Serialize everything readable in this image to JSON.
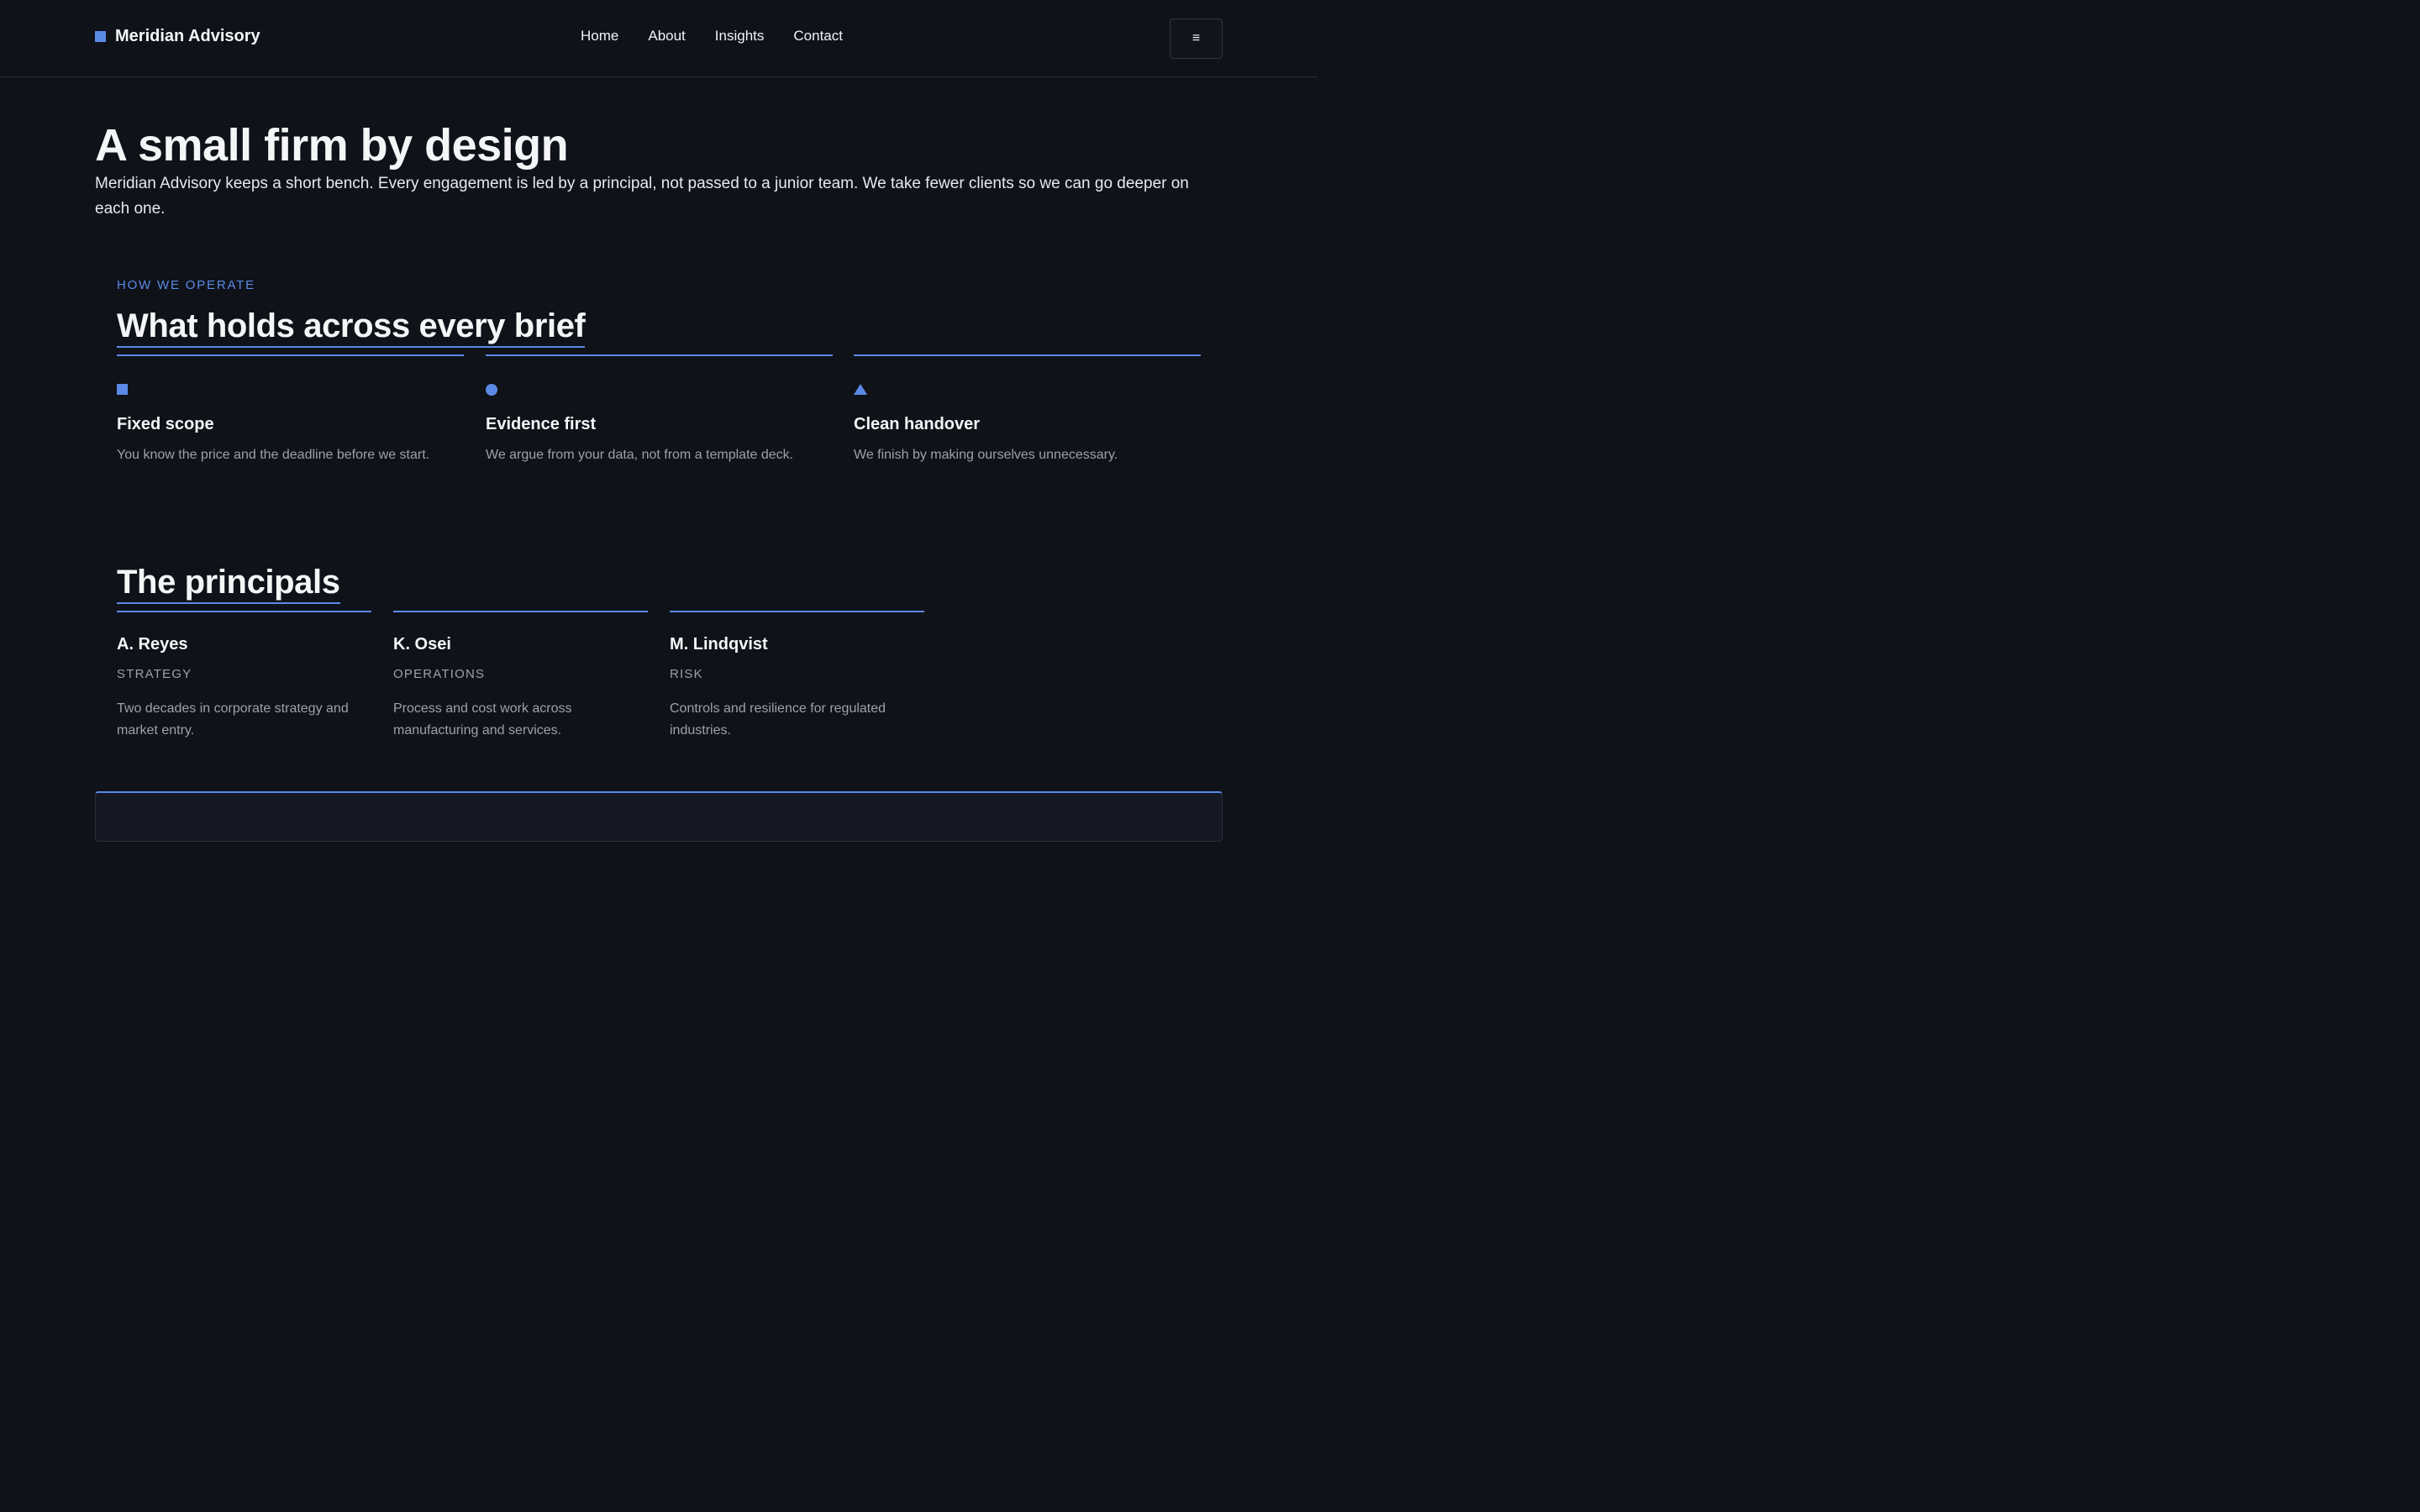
{
  "header": {
    "brand": "Meridian Advisory",
    "nav": [
      "Home",
      "About",
      "Insights",
      "Contact"
    ],
    "menu_icon": "≡"
  },
  "hero": {
    "title": "A small firm by design",
    "text": "Meridian Advisory keeps a short bench. Every engagement is led by a principal, not passed to a junior team. We take fewer clients so we can go deeper on each one."
  },
  "operate": {
    "eyebrow": "HOW WE OPERATE",
    "heading": "What holds across every brief",
    "items": [
      {
        "icon": "square-icon",
        "title": "Fixed scope",
        "desc": "You know the price and the deadline before we start."
      },
      {
        "icon": "circle-icon",
        "title": "Evidence first",
        "desc": "We argue from your data, not from a template deck."
      },
      {
        "icon": "triangle-icon",
        "title": "Clean handover",
        "desc": "We finish by making ourselves unnecessary."
      }
    ]
  },
  "principals": {
    "heading": "The principals",
    "people": [
      {
        "name": "A. Reyes",
        "role": "STRATEGY",
        "bio": "Two decades in corporate strategy and market entry."
      },
      {
        "name": "K. Osei",
        "role": "OPERATIONS",
        "bio": "Process and cost work across manufacturing and services."
      },
      {
        "name": "M. Lindqvist",
        "role": "RISK",
        "bio": "Controls and resilience for regulated industries."
      }
    ]
  },
  "colors": {
    "accent": "#5b8ae6",
    "background": "#0f1219",
    "muted": "#9ba1ad"
  }
}
